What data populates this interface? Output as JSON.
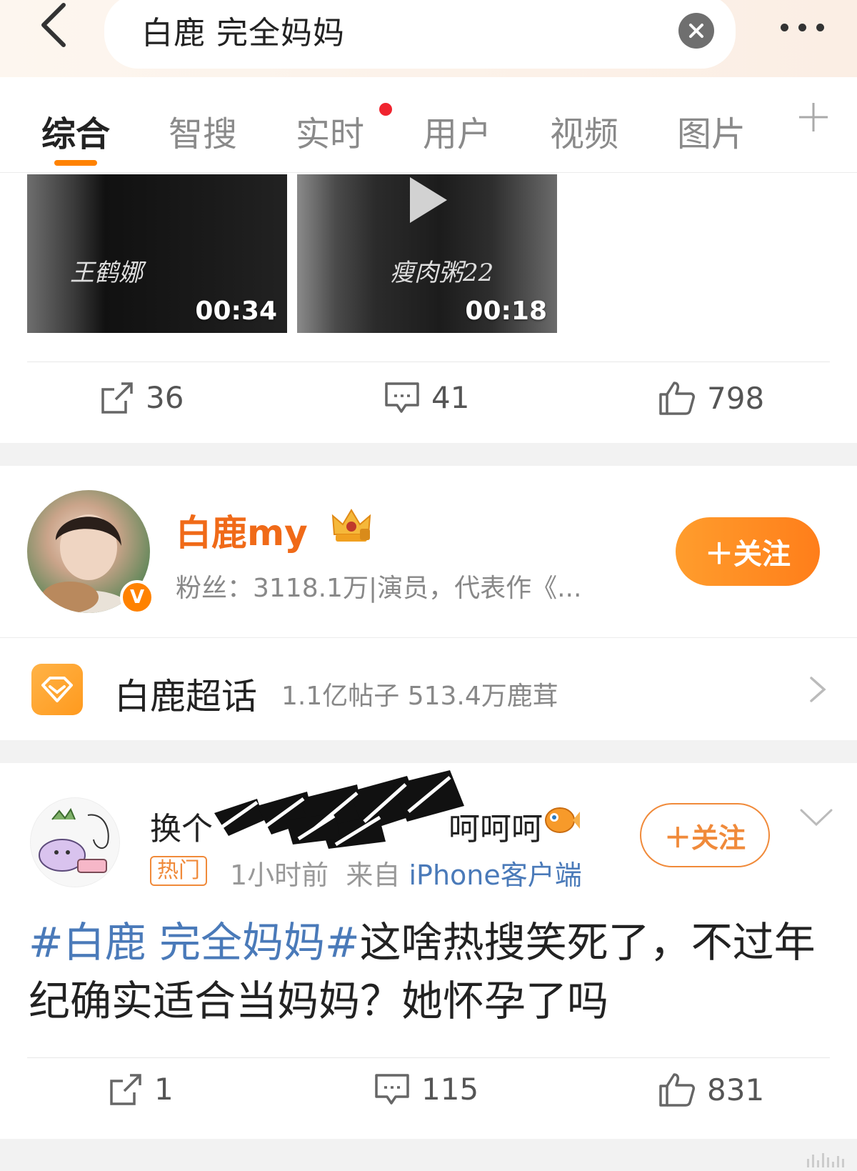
{
  "search": {
    "query": "白鹿 完全妈妈"
  },
  "tabs": [
    "综合",
    "智搜",
    "实时",
    "用户",
    "视频",
    "图片"
  ],
  "video_post": {
    "videos": [
      {
        "duration": "00:34",
        "watermark": "王鹤娜"
      },
      {
        "duration": "00:18",
        "watermark": "瘦肉粥22"
      }
    ],
    "reposts": "36",
    "comments": "41",
    "likes": "798"
  },
  "user_card": {
    "name": "白鹿my",
    "fans": "粉丝：3118.1万|演员，代表作《...",
    "follow_label": "＋关注"
  },
  "topic": {
    "name": "白鹿超话",
    "meta": "1.1亿帖子  513.4万鹿茸"
  },
  "post": {
    "author_visible": "换个",
    "author_tail": "呵呵呵",
    "hot_label": "热门",
    "time": "1小时前",
    "from_label": "来自",
    "source": "iPhone客户端",
    "follow_label": "＋关注",
    "hashtag": "#白鹿 完全妈妈#",
    "body": "这啥热搜笑死了，不过年纪确实适合当妈妈？她怀孕了吗",
    "reposts": "1",
    "comments": "115",
    "likes": "831"
  },
  "colors": {
    "accent": "#ff8200",
    "link": "#4a7ab9",
    "name_orange": "#f06a18"
  }
}
